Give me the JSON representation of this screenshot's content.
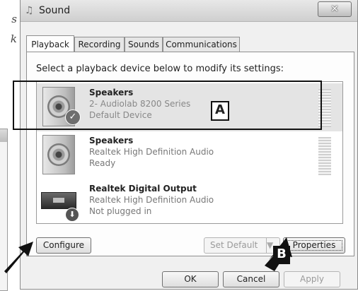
{
  "left_page": {
    "lines": [
      "s",
      "k"
    ]
  },
  "window": {
    "title": "Sound",
    "close_glyph": "✕",
    "title_icon": "speaker-icon"
  },
  "tabs": [
    {
      "label": "Playback",
      "active": true
    },
    {
      "label": "Recording",
      "active": false
    },
    {
      "label": "Sounds",
      "active": false
    },
    {
      "label": "Communications",
      "active": false
    }
  ],
  "instruction": "Select a playback device below to modify its settings:",
  "devices": [
    {
      "name": "Speakers",
      "description": "2- Audiolab 8200 Series",
      "status": "Default Device",
      "selected": true,
      "icon": "speaker-icon",
      "badge": "check-icon"
    },
    {
      "name": "Speakers",
      "description": "Realtek High Definition Audio",
      "status": "Ready",
      "selected": false,
      "icon": "speaker-icon"
    },
    {
      "name": "Realtek Digital Output",
      "description": "Realtek High Definition Audio",
      "status": "Not plugged in",
      "selected": false,
      "icon": "receiver-icon",
      "badge": "down-arrow-icon"
    }
  ],
  "buttons": {
    "configure": "Configure",
    "set_default": "Set Default",
    "properties": "Properties",
    "ok": "OK",
    "cancel": "Cancel",
    "apply": "Apply"
  },
  "annotations": {
    "a": "A",
    "b": "B"
  }
}
